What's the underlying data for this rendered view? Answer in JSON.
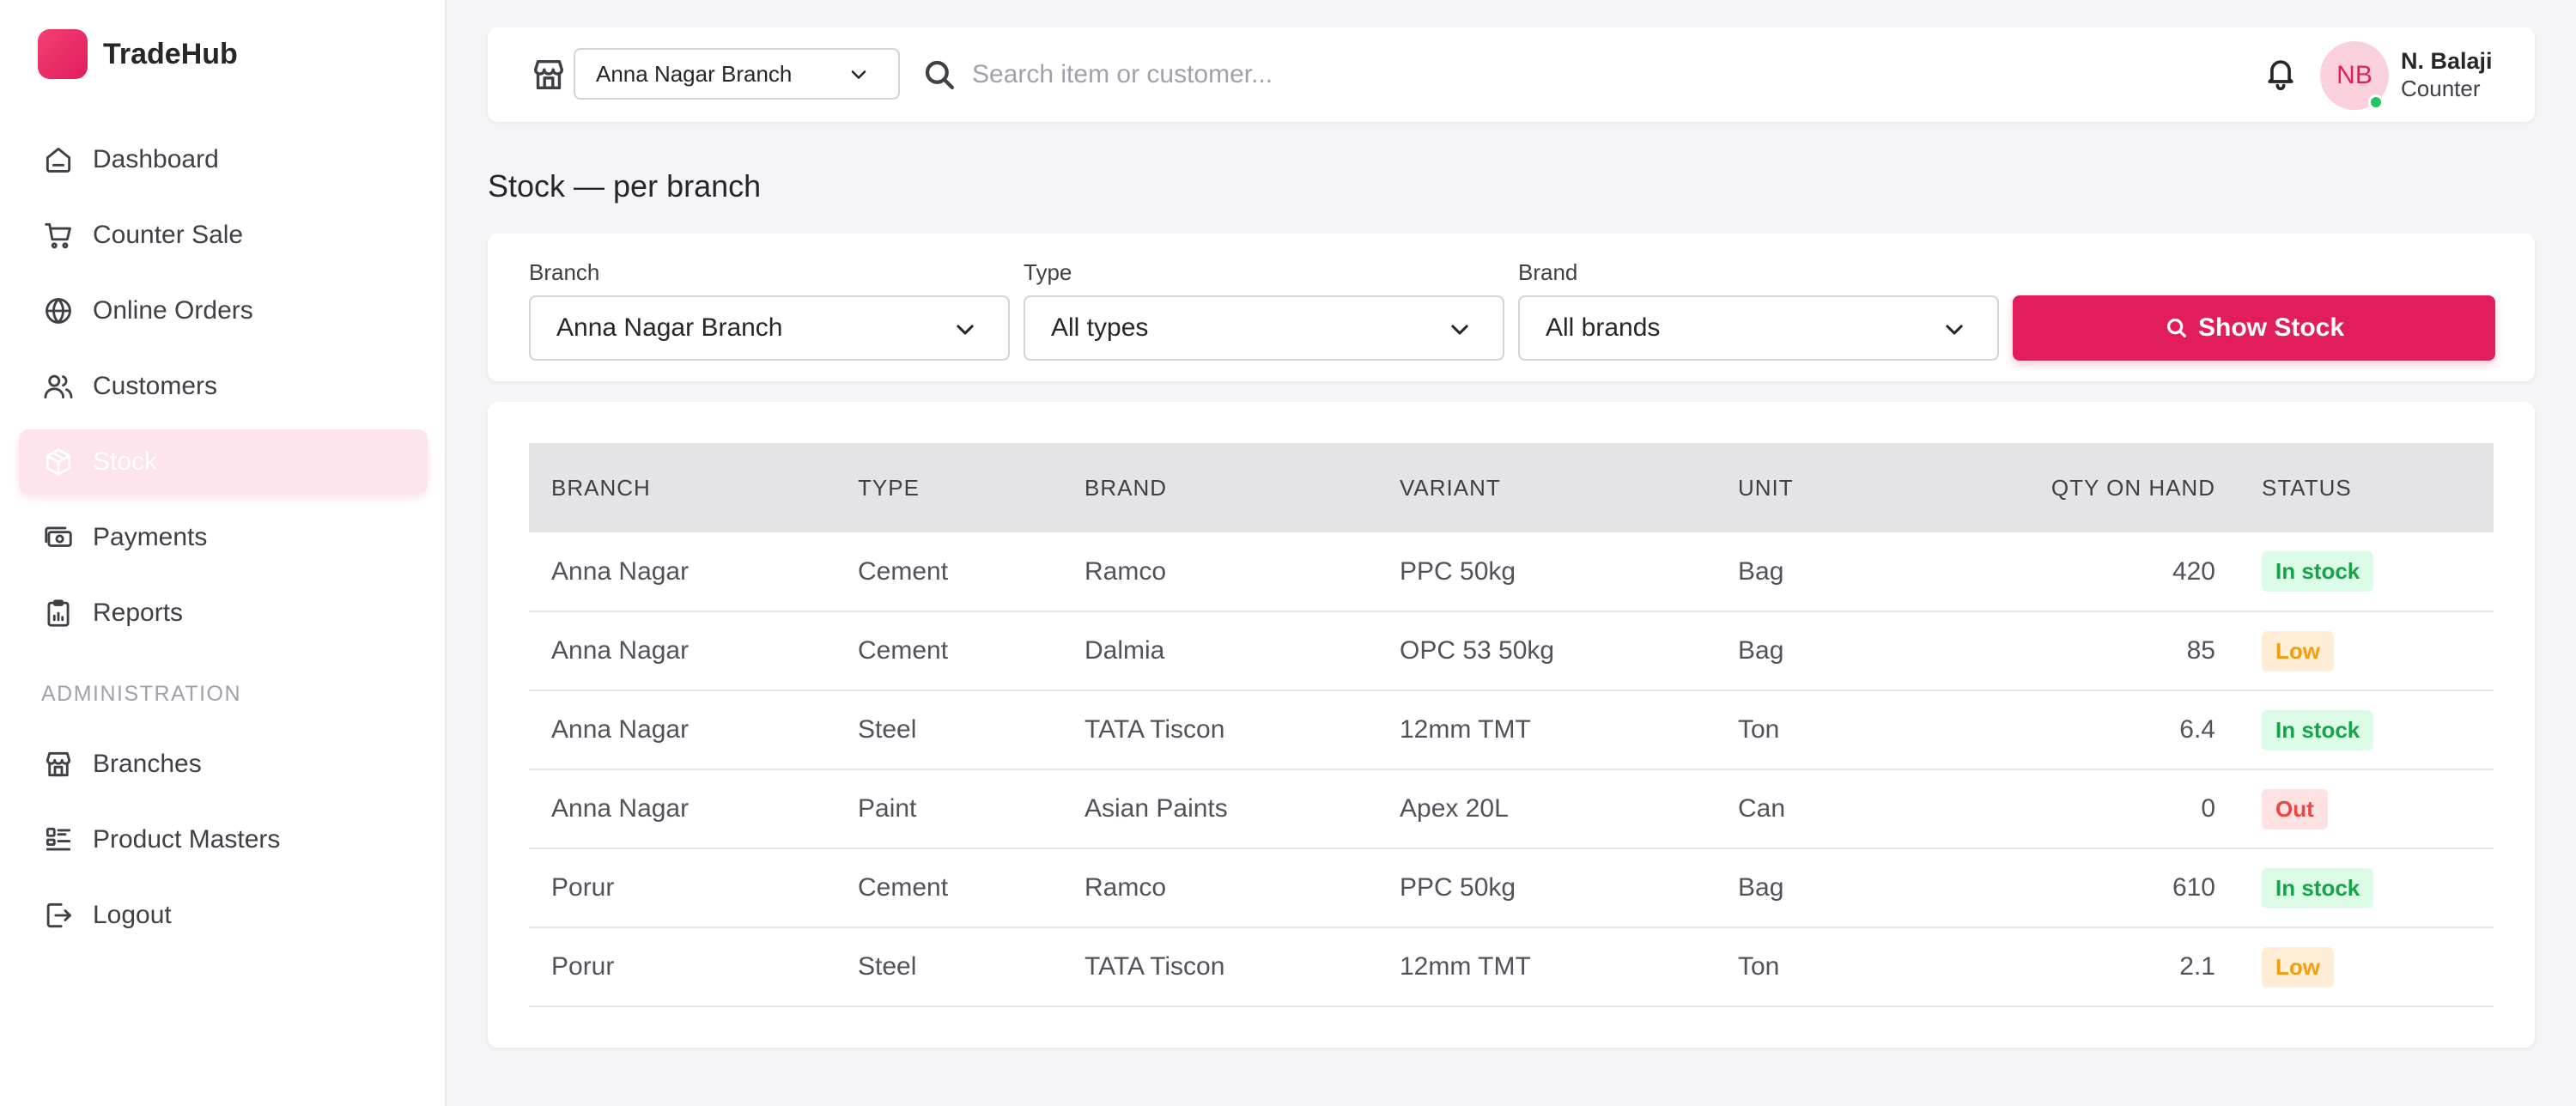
{
  "app": {
    "name": "TradeHub",
    "accent": "#e11d5b"
  },
  "sidebar": {
    "items": [
      {
        "label": "Dashboard",
        "icon": "home-icon"
      },
      {
        "label": "Counter Sale",
        "icon": "cart-icon"
      },
      {
        "label": "Online Orders",
        "icon": "globe-icon"
      },
      {
        "label": "Customers",
        "icon": "users-icon"
      },
      {
        "label": "Stock",
        "icon": "box-icon",
        "active": true
      },
      {
        "label": "Payments",
        "icon": "cash-icon"
      },
      {
        "label": "Reports",
        "icon": "clipboard-chart-icon"
      }
    ],
    "section_label": "ADMINISTRATION",
    "admin_items": [
      {
        "label": "Branches",
        "icon": "store-icon"
      },
      {
        "label": "Product Masters",
        "icon": "list-icon"
      },
      {
        "label": "Logout",
        "icon": "logout-icon"
      }
    ]
  },
  "topbar": {
    "branch": "Anna Nagar Branch",
    "search_placeholder": "Search item or customer...",
    "user": {
      "initials": "NB",
      "name": "N. Balaji",
      "role": "Counter",
      "online_color": "#22c55e"
    }
  },
  "page": {
    "title": "Stock — per branch"
  },
  "filters": {
    "branch_label": "Branch",
    "branch_value": "Anna Nagar Branch",
    "type_label": "Type",
    "type_value": "All types",
    "brand_label": "Brand",
    "brand_value": "All brands",
    "show_button": "Show Stock"
  },
  "table": {
    "headers": [
      "BRANCH",
      "TYPE",
      "BRAND",
      "VARIANT",
      "UNIT",
      "QTY ON HAND",
      "STATUS"
    ],
    "rows": [
      {
        "branch": "Anna Nagar",
        "type": "Cement",
        "brand": "Ramco",
        "variant": "PPC 50kg",
        "unit": "Bag",
        "qty": "420",
        "status": "In stock",
        "status_kind": "ok"
      },
      {
        "branch": "Anna Nagar",
        "type": "Cement",
        "brand": "Dalmia",
        "variant": "OPC 53 50kg",
        "unit": "Bag",
        "qty": "85",
        "status": "Low",
        "status_kind": "low"
      },
      {
        "branch": "Anna Nagar",
        "type": "Steel",
        "brand": "TATA Tiscon",
        "variant": "12mm TMT",
        "unit": "Ton",
        "qty": "6.4",
        "status": "In stock",
        "status_kind": "ok"
      },
      {
        "branch": "Anna Nagar",
        "type": "Paint",
        "brand": "Asian Paints",
        "variant": "Apex 20L",
        "unit": "Can",
        "qty": "0",
        "status": "Out",
        "status_kind": "out"
      },
      {
        "branch": "Porur",
        "type": "Cement",
        "brand": "Ramco",
        "variant": "PPC 50kg",
        "unit": "Bag",
        "qty": "610",
        "status": "In stock",
        "status_kind": "ok"
      },
      {
        "branch": "Porur",
        "type": "Steel",
        "brand": "TATA Tiscon",
        "variant": "12mm TMT",
        "unit": "Ton",
        "qty": "2.1",
        "status": "Low",
        "status_kind": "low"
      }
    ],
    "status_colors": {
      "ok": {
        "bg": "#dcfce7",
        "fg": "#16a34a"
      },
      "low": {
        "bg": "#ffedd5",
        "fg": "#f59e0b"
      },
      "out": {
        "bg": "#fee2e2",
        "fg": "#ef4444"
      }
    }
  }
}
